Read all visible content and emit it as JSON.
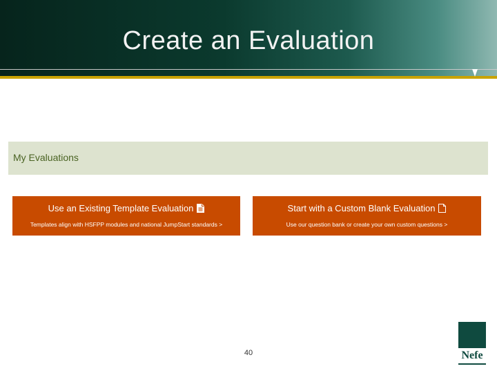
{
  "slide": {
    "title": "Create an Evaluation",
    "page_number": "40"
  },
  "panel": {
    "title": "My Evaluations"
  },
  "cards": [
    {
      "title": "Use an Existing Template Evaluation",
      "subtitle": "Templates align with HSFPP modules and national JumpStart standards >",
      "icon": "filled-document-icon"
    },
    {
      "title": "Start with a Custom Blank Evaluation",
      "subtitle": "Use our question bank or create your own custom questions >",
      "icon": "blank-document-icon"
    }
  ],
  "logo": {
    "text": "Nefe"
  },
  "colors": {
    "header_dark": "#06241c",
    "header_light": "#8fb8b1",
    "gold_rule": "#c9a300",
    "panel_bg": "#dde3cf",
    "panel_text": "#4a6323",
    "card_bg": "#c84b00",
    "logo_green": "#0f4a3f"
  }
}
